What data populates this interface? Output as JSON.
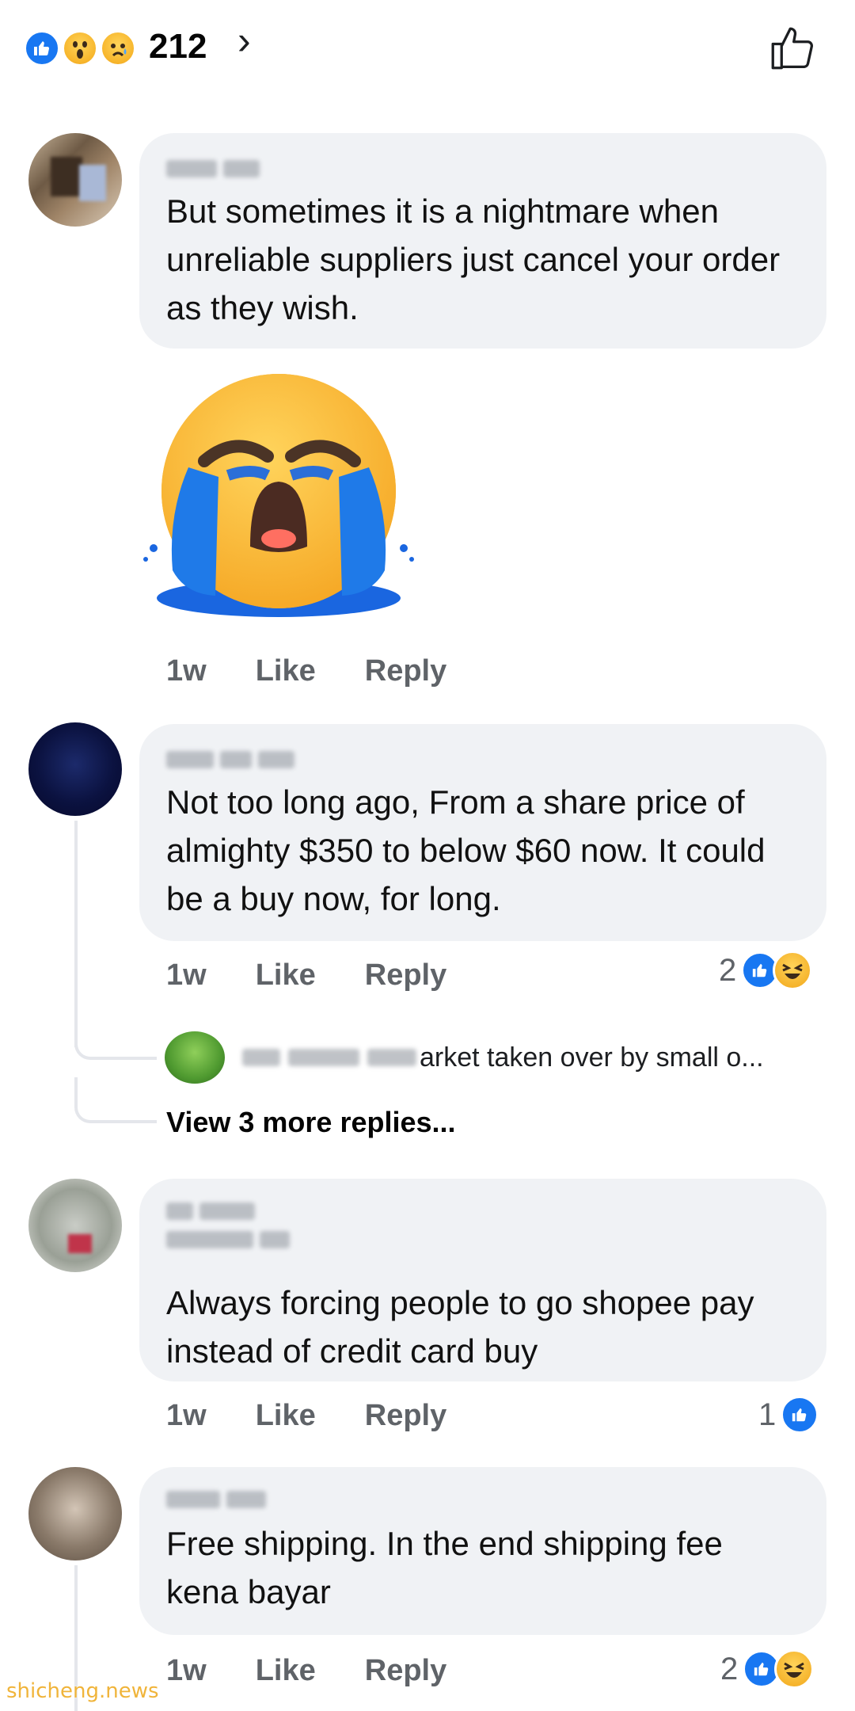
{
  "header": {
    "reaction_count": "212",
    "reactions": [
      "like-icon",
      "wow-icon",
      "sad-icon"
    ],
    "chevron": "›"
  },
  "comments": [
    {
      "text": "But sometimes it is a nightmare when unreliable suppliers just cancel your order as they wish.",
      "time": "1w",
      "like": "Like",
      "reply": "Reply",
      "sticker": "crying-face-sticker"
    },
    {
      "text": "Not too long ago, From a share price of almighty $350 to below $60 now. It could be a buy now, for long.",
      "time": "1w",
      "like": "Like",
      "reply": "Reply",
      "reaction_count": "2",
      "reply_preview": "arket taken over by small o...",
      "view_more": "View 3 more replies..."
    },
    {
      "text": "Always forcing people to go shopee pay instead of credit card buy",
      "time": "1w",
      "like": "Like",
      "reply": "Reply",
      "reaction_count": "1"
    },
    {
      "text": "Free shipping. In the end shipping fee kena bayar",
      "time": "1w",
      "like": "Like",
      "reply": "Reply",
      "reaction_count": "2"
    }
  ],
  "watermark": "shicheng.news",
  "colors": {
    "accent": "#1877f2",
    "bubble": "#f0f2f5",
    "meta": "#5f6368"
  }
}
